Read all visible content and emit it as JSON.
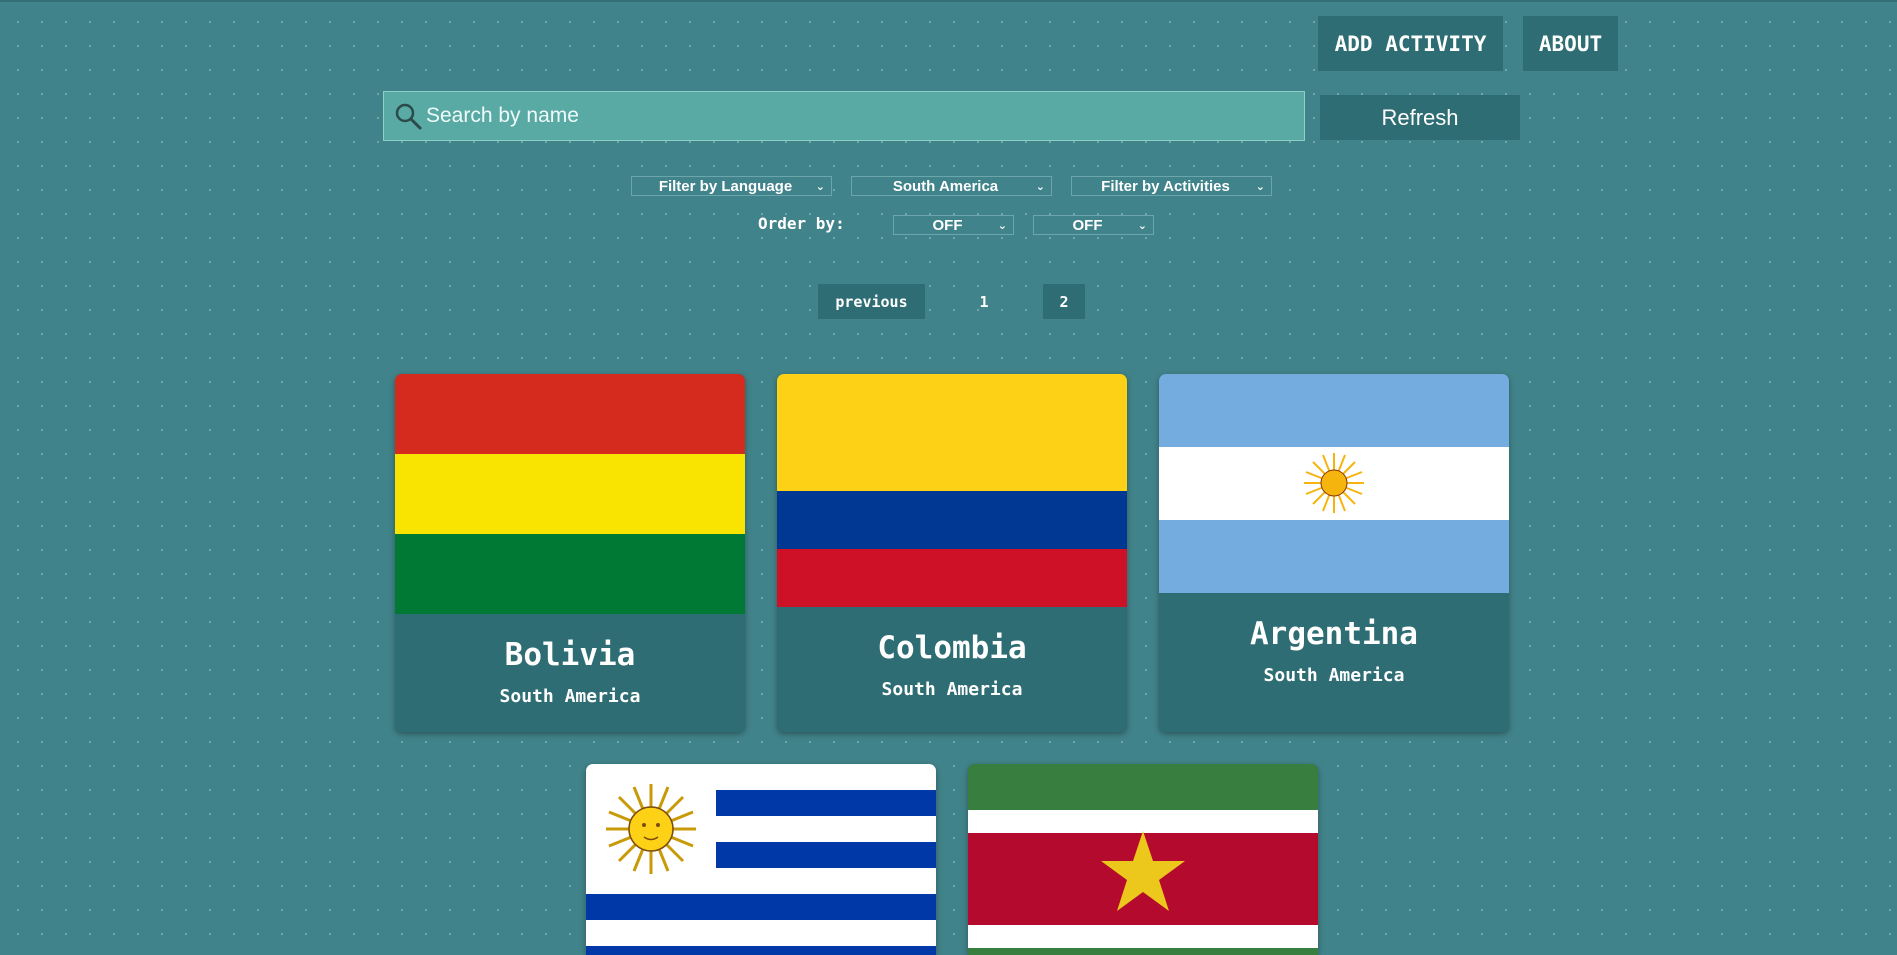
{
  "nav": {
    "add_activity": "ADD ACTIVITY",
    "about": "ABOUT"
  },
  "search": {
    "placeholder": "Search by name",
    "value": "",
    "icon": "search-icon"
  },
  "refresh_label": "Refresh",
  "filters": {
    "language": "Filter by Language",
    "continent": "South America",
    "activities": "Filter by Activities"
  },
  "order": {
    "label": "Order by:",
    "first": "OFF",
    "second": "OFF"
  },
  "pagination": {
    "previous": "previous",
    "pages": [
      "1",
      "2"
    ],
    "current": "2"
  },
  "countries": [
    {
      "name": "Bolivia",
      "continent": "South America",
      "flag": "bolivia-flag"
    },
    {
      "name": "Colombia",
      "continent": "South America",
      "flag": "colombia-flag"
    },
    {
      "name": "Argentina",
      "continent": "South America",
      "flag": "argentina-flag"
    },
    {
      "name": "",
      "continent": "",
      "flag": "uruguay-flag"
    },
    {
      "name": "",
      "continent": "",
      "flag": "suriname-flag"
    }
  ],
  "colors": {
    "background": "#41838a",
    "panel": "#2e6d73",
    "search_bg": "#59aaa4"
  }
}
